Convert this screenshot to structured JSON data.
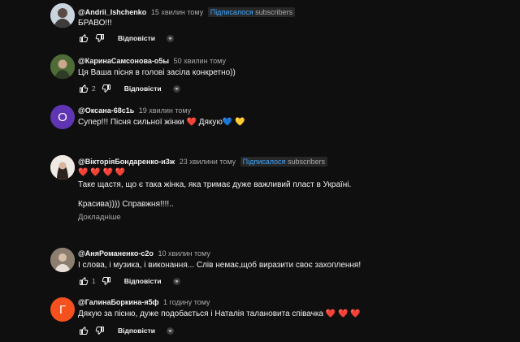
{
  "comments": [
    {
      "author": "@Andrii_Ishchenko",
      "time": "15 хвилин тому",
      "badge_ua": "Підписалося",
      "badge_en": "subscribers",
      "text": "БРАВО!!!",
      "likes": "",
      "reply": "Відповісти"
    },
    {
      "author": "@КаринаСамсонова-о5ы",
      "time": "50 хвилин тому",
      "text": "Ця Ваша пісня в голові засіла конкретно))",
      "likes": "2",
      "reply": "Відповісти"
    },
    {
      "author": "@Оксана-68с1ь",
      "time": "19 хвилин тому",
      "avatar_letter": "О",
      "avatar_color": "#5f35b3",
      "text": "Супер!!! Пісня сильної жінки ❤️ Дякую💙 💛",
      "likes": "",
      "reply": "Відповісти"
    },
    {
      "author": "@ВікторіяБондаренко-и3ж",
      "time": "23 хвилини тому",
      "badge_ua": "Підписалося",
      "badge_en": "subscribers",
      "hearts": "❤️ ❤️ ❤️ ❤️",
      "text": "Таке щастя, що є така жінка, яка тримає дуже важливий пласт в Україні.",
      "text2": "Красива)))) Справжня!!!!..",
      "more": "Докладніше"
    },
    {
      "author": "@АняРоманенко-с2о",
      "time": "10 хвилин тому",
      "text": "І слова, і музика, і виконання... Слів немає,щоб виразити своє захоплення!",
      "likes": "1",
      "reply": "Відповісти"
    },
    {
      "author": "@ГалинаБоркина-я5ф",
      "time": "1 годину тому",
      "avatar_letter": "Г",
      "avatar_color": "#f4511e",
      "text": "Дякую за пісню, дуже подобається і Наталія талановита співачка ❤️ ❤️ ❤️",
      "likes": "",
      "reply": "Відповісти"
    }
  ]
}
